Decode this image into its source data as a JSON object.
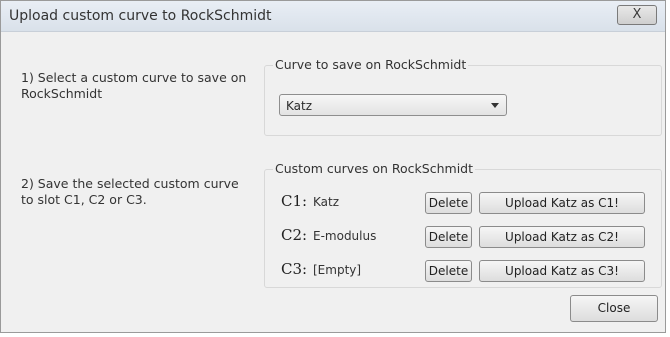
{
  "window": {
    "title": "Upload custom curve to RockSchmidt",
    "close_glyph": "X"
  },
  "steps": {
    "step1": "1)  Select a custom curve to save on RockSchmidt",
    "step2": "2)  Save the selected custom curve to slot C1, C2 or C3."
  },
  "save_group": {
    "title": "Curve to save on RockSchmidt",
    "selected_curve": "Katz"
  },
  "slots_group": {
    "title": "Custom curves on RockSchmidt",
    "slots": [
      {
        "name": "C1:",
        "curve": "Katz",
        "delete_label": "Delete",
        "upload_label": "Upload Katz as C1!"
      },
      {
        "name": "C2:",
        "curve": "E-modulus",
        "delete_label": "Delete",
        "upload_label": "Upload Katz as C2!"
      },
      {
        "name": "C3:",
        "curve": "[Empty]",
        "delete_label": "Delete",
        "upload_label": "Upload Katz as C3!"
      }
    ]
  },
  "footer": {
    "close_label": "Close"
  }
}
